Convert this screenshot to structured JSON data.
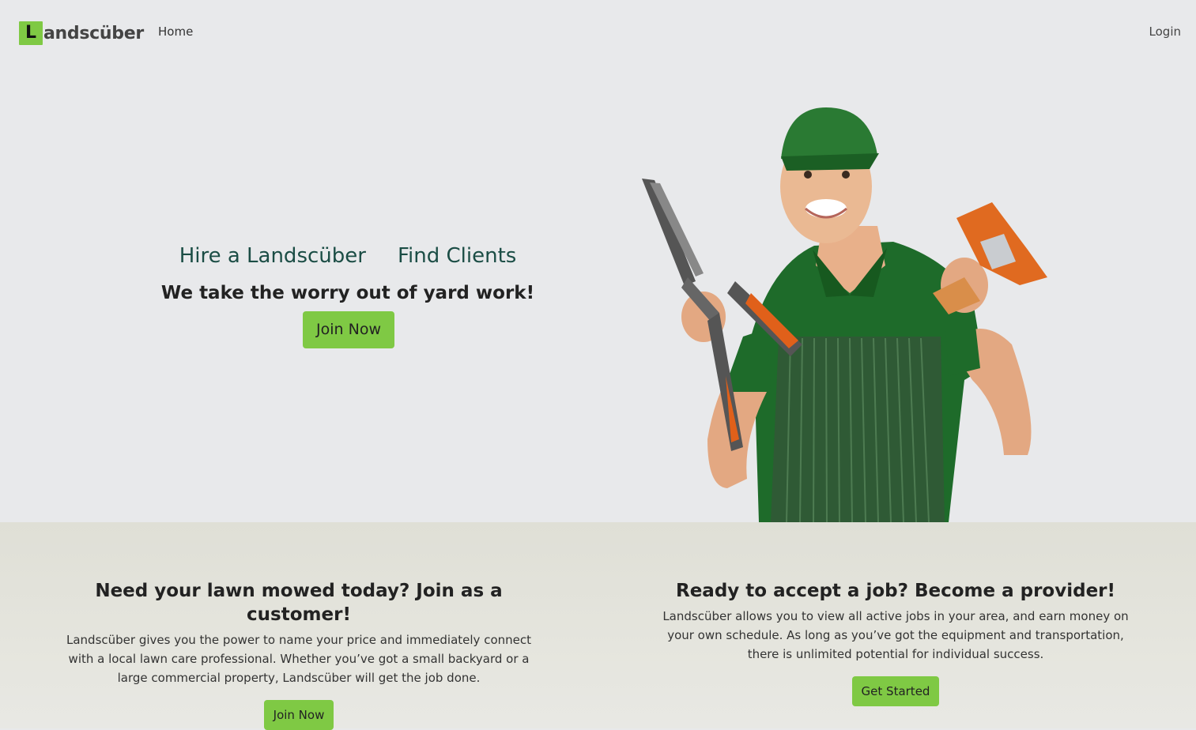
{
  "nav": {
    "logo_letter": "L",
    "logo_text": "andscüber",
    "home": "Home",
    "login": "Login"
  },
  "hero": {
    "link_hire": "Hire a Landscüber",
    "link_find": "Find Clients",
    "tagline": "We take the worry out of yard work!",
    "button": "Join Now"
  },
  "customer": {
    "heading": "Need your lawn mowed today? Join as a customer!",
    "body": "Landscüber gives you the power to name your price and immediately connect with a local lawn care professional. Whether you’ve got a small backyard or a large commercial property, Landscüber will get the job done.",
    "button": "Join Now"
  },
  "provider": {
    "heading": "Ready to accept a job? Become a provider!",
    "body": "Landscüber allows you to view all active jobs in your area, and earn money on your own schedule. As long as you’ve got the equipment and transportation, there is unlimited potential for individual success.",
    "button": "Get Started"
  },
  "colors": {
    "brand_green": "#7fc944",
    "hero_link": "#1b4d45",
    "hero_bg": "#e8e9eb",
    "bottom_bg": "#dfdfd6"
  }
}
